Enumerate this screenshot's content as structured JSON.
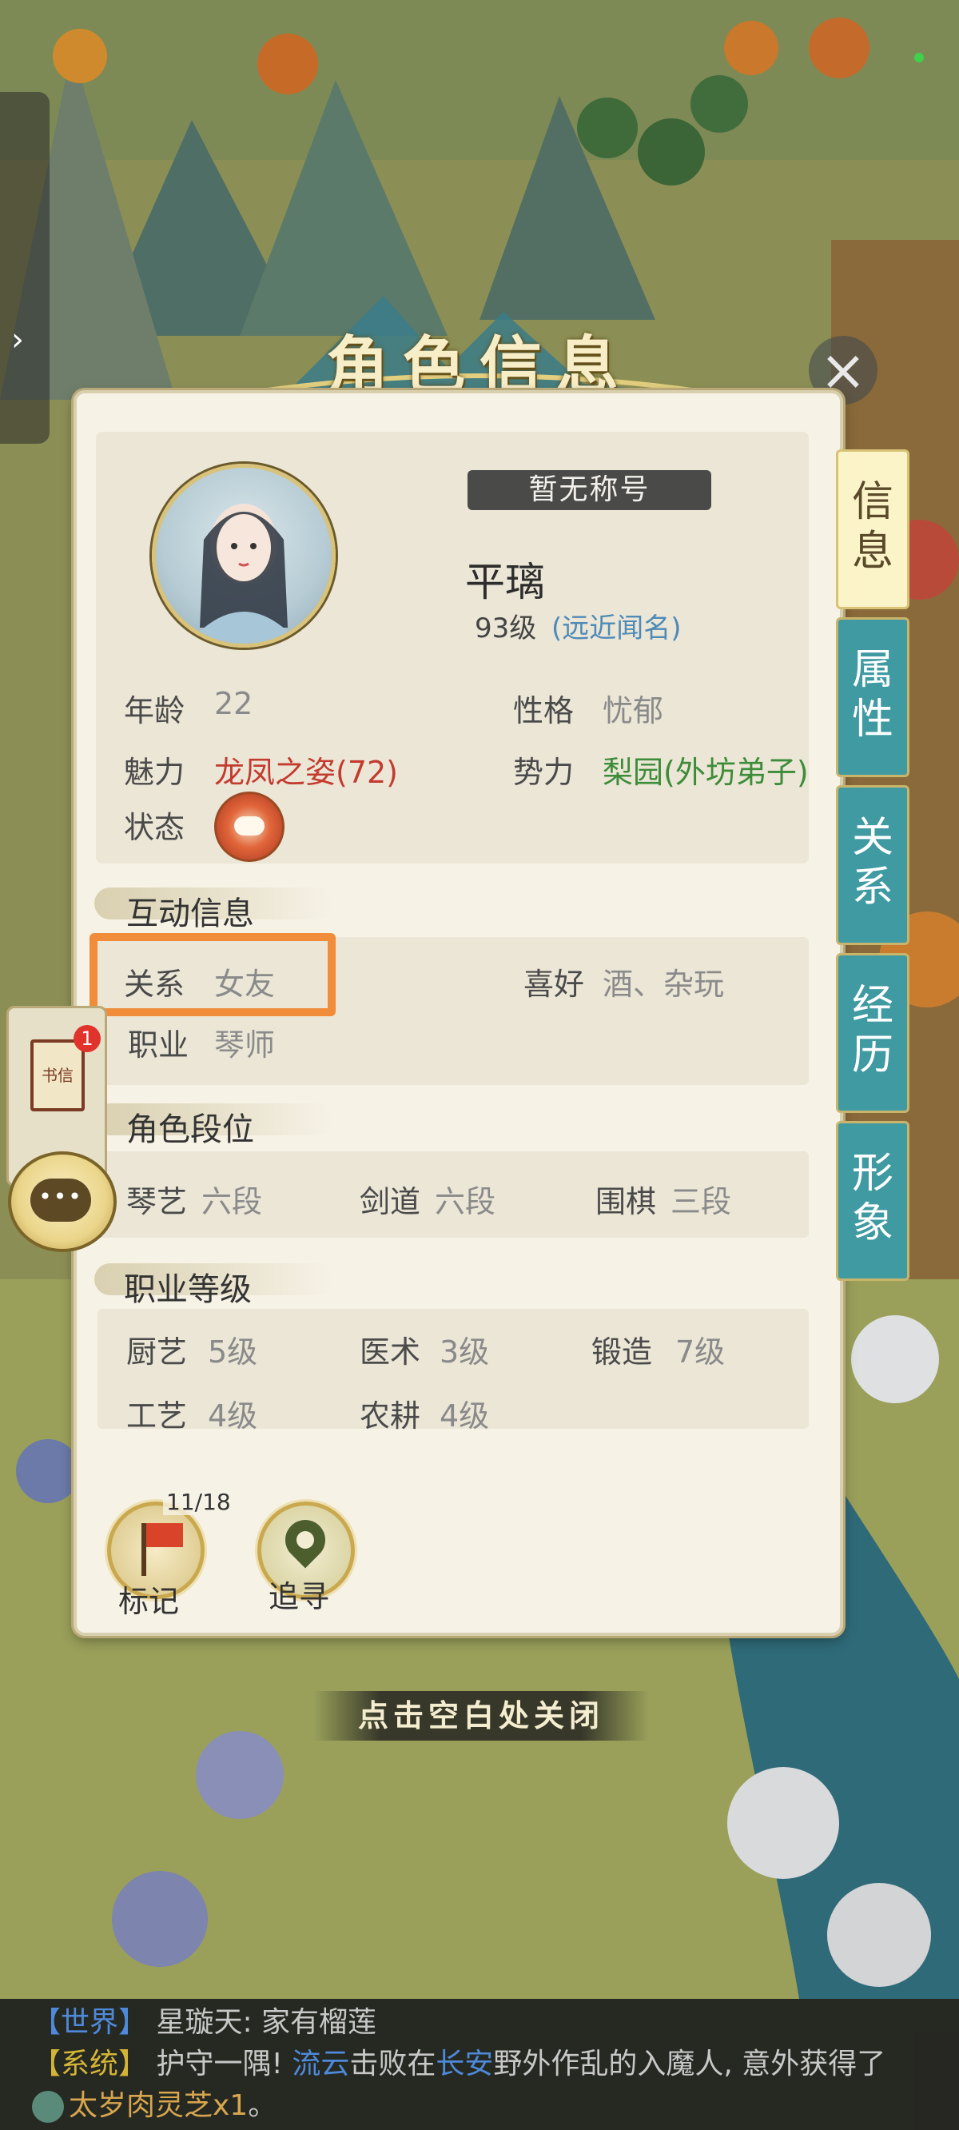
{
  "header": {
    "title": "角色信息",
    "close_icon": "close-icon"
  },
  "profile": {
    "title_badge": "暂无称号",
    "name": "平璃",
    "level": "93级",
    "fame": "(远近闻名)",
    "fields": {
      "age_label": "年龄",
      "age_value": "22",
      "personality_label": "性格",
      "personality_value": "忧郁",
      "charm_label": "魅力",
      "charm_value": "龙凤之姿(72)",
      "faction_label": "势力",
      "faction_value": "梨园(外坊弟子)",
      "status_label": "状态"
    }
  },
  "interaction": {
    "heading": "互动信息",
    "relation_label": "关系",
    "relation_value": "女友",
    "hobby_label": "喜好",
    "hobby_value": "酒、杂玩",
    "job_label": "职业",
    "job_value": "琴师"
  },
  "rank": {
    "heading": "角色段位",
    "items": [
      {
        "label": "琴艺",
        "value": "六段"
      },
      {
        "label": "剑道",
        "value": "六段"
      },
      {
        "label": "围棋",
        "value": "三段"
      }
    ]
  },
  "job_level": {
    "heading": "职业等级",
    "items": [
      {
        "label": "厨艺",
        "value": "5级"
      },
      {
        "label": "医术",
        "value": "3级"
      },
      {
        "label": "锻造",
        "value": "7级"
      },
      {
        "label": "工艺",
        "value": "4级"
      },
      {
        "label": "农耕",
        "value": "4级"
      }
    ]
  },
  "actions": {
    "mark_label": "标记",
    "mark_count": "11/18",
    "seek_label": "追寻"
  },
  "side_tabs": [
    {
      "label": "信息",
      "active": true
    },
    {
      "label": "属性",
      "active": false
    },
    {
      "label": "关系",
      "active": false
    },
    {
      "label": "经历",
      "active": false
    },
    {
      "label": "形象",
      "active": false
    }
  ],
  "left_dock": {
    "letter_text": "书信",
    "badge_count": "1",
    "chat_dots": "•••"
  },
  "close_hint": "点击空白处关闭",
  "chat": {
    "line1_channel": "【世界】",
    "line1_text": "星璇天: 家有榴莲",
    "line2_channel": "【系统】",
    "line2_a": "护守一隅! ",
    "line2_name": "流云",
    "line2_b": "击败在",
    "line2_place": "长安",
    "line2_c": "野外作乱的入魔人, 意外获得了",
    "line3_item": "太岁肉灵芝x1",
    "line3_end": "。"
  },
  "colors": {
    "panel_bg": "#f6f2e6",
    "tab_teal": "#3f9aa2",
    "highlight_orange": "#f08c3a",
    "charm_red": "#c33a2e",
    "faction_green": "#3d8c3a",
    "fame_blue": "#4d8ab8"
  }
}
